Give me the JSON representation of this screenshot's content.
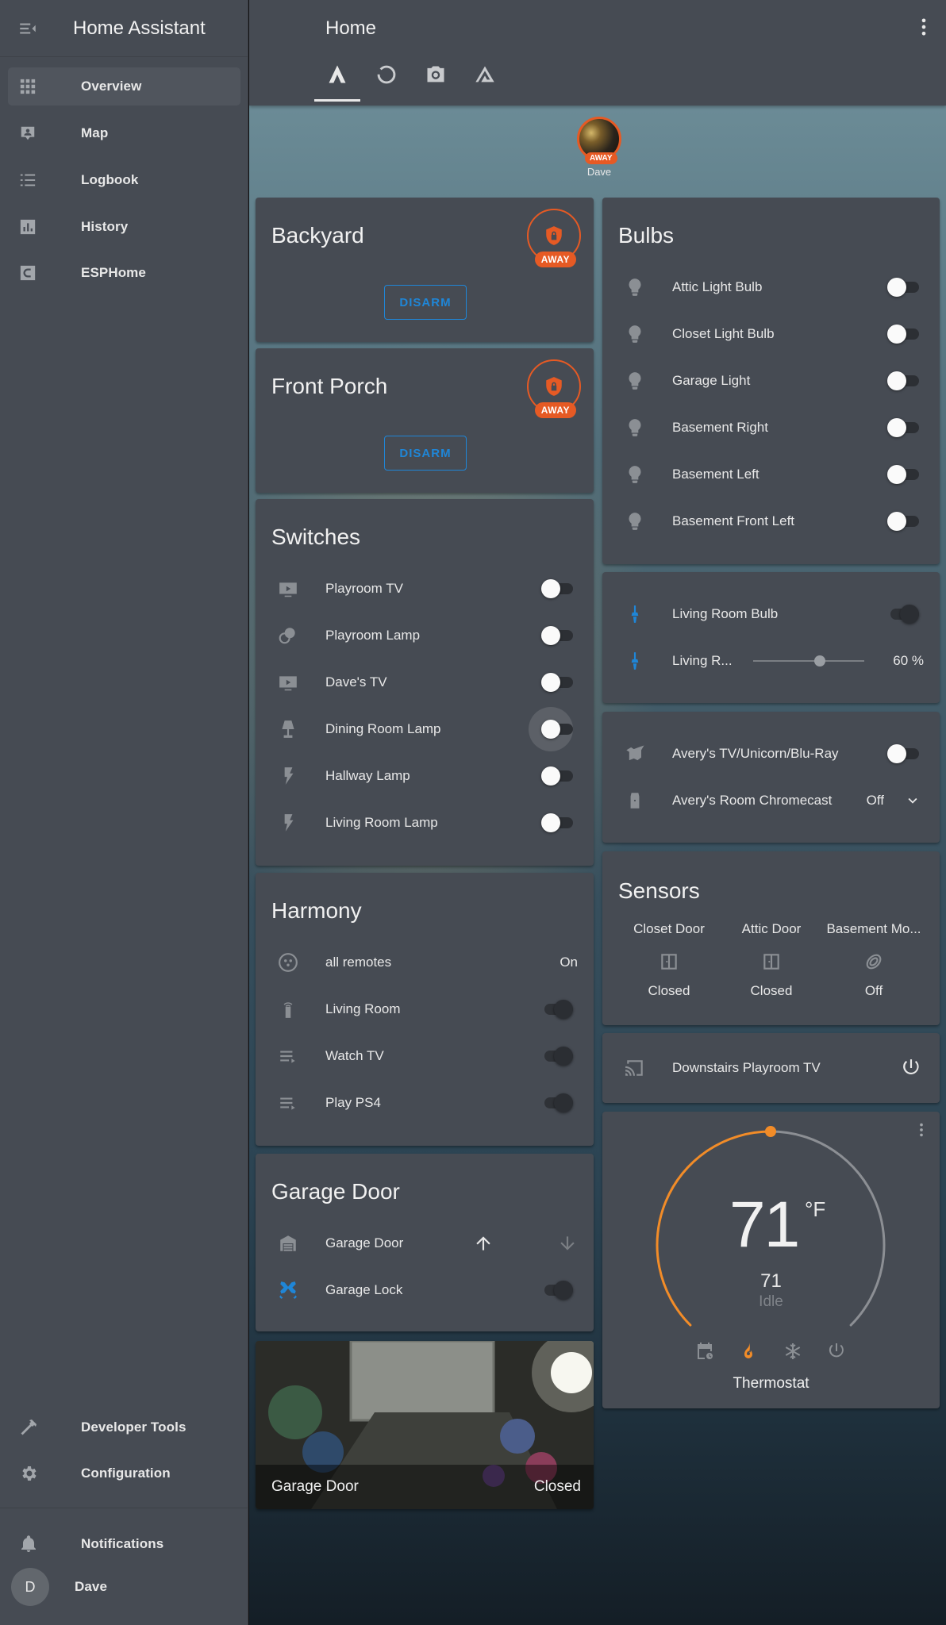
{
  "sidebar": {
    "title": "Home Assistant",
    "items": [
      {
        "label": "Overview",
        "icon": "grid-icon",
        "active": true
      },
      {
        "label": "Map",
        "icon": "map-icon"
      },
      {
        "label": "Logbook",
        "icon": "list-icon"
      },
      {
        "label": "History",
        "icon": "chart-icon"
      },
      {
        "label": "ESPHome",
        "icon": "esphome-icon"
      }
    ],
    "bottom_items": [
      {
        "label": "Developer Tools",
        "icon": "hammer-icon"
      },
      {
        "label": "Configuration",
        "icon": "gear-icon"
      }
    ],
    "notifications": "Notifications",
    "user": {
      "name": "Dave",
      "initial": "D"
    }
  },
  "header": {
    "title": "Home",
    "tabs": [
      "home-icon",
      "circle-icon",
      "camera-icon",
      "triangle-icon"
    ],
    "active_tab": 0
  },
  "badge": {
    "name": "Dave",
    "label": "AWAY",
    "color": "#e65a24"
  },
  "alarms": [
    {
      "title": "Backyard",
      "state": "AWAY",
      "action": "DISARM"
    },
    {
      "title": "Front Porch",
      "state": "AWAY",
      "action": "DISARM"
    }
  ],
  "switches": {
    "title": "Switches",
    "items": [
      {
        "label": "Playroom TV",
        "icon": "tv-icon",
        "on": false
      },
      {
        "label": "Playroom Lamp",
        "icon": "lamp-icon",
        "on": false
      },
      {
        "label": "Dave's TV",
        "icon": "tv-icon",
        "on": false
      },
      {
        "label": "Dining Room Lamp",
        "icon": "floor-lamp-icon",
        "on": false,
        "focused": true
      },
      {
        "label": "Hallway Lamp",
        "icon": "flash-icon",
        "on": false
      },
      {
        "label": "Living Room Lamp",
        "icon": "flash-icon",
        "on": false
      }
    ]
  },
  "harmony": {
    "title": "Harmony",
    "items": [
      {
        "label": "all remotes",
        "icon": "remote-icon",
        "state": "On"
      },
      {
        "label": "Living Room",
        "icon": "remote-tv-icon",
        "on": true
      },
      {
        "label": "Watch TV",
        "icon": "playlist-icon",
        "on": true
      },
      {
        "label": "Play PS4",
        "icon": "playlist-icon",
        "on": true
      }
    ]
  },
  "garage": {
    "title": "Garage Door",
    "door_label": "Garage Door",
    "lock_label": "Garage Lock",
    "lock_on": true
  },
  "camera": {
    "name": "Garage Door",
    "state": "Closed"
  },
  "bulbs": {
    "title": "Bulbs",
    "items": [
      {
        "label": "Attic Light Bulb",
        "on": false
      },
      {
        "label": "Closet Light Bulb",
        "on": false
      },
      {
        "label": "Garage Light",
        "on": false
      },
      {
        "label": "Basement Right",
        "on": false
      },
      {
        "label": "Basement Left",
        "on": false
      },
      {
        "label": "Basement Front Left",
        "on": false
      }
    ]
  },
  "living": {
    "bulb_label": "Living Room Bulb",
    "bulb_on": true,
    "slider_label": "Living R...",
    "brightness": 60,
    "brightness_text": "60 %",
    "accent": "#1f86d7"
  },
  "avery": {
    "tv_label": "Avery's TV/Unicorn/Blu-Ray",
    "tv_on": false,
    "chromecast_label": "Avery's Room Chromecast",
    "chromecast_state": "Off"
  },
  "sensors": {
    "title": "Sensors",
    "items": [
      {
        "name": "Closet Door",
        "icon": "door-icon",
        "state": "Closed"
      },
      {
        "name": "Attic Door",
        "icon": "door-icon",
        "state": "Closed"
      },
      {
        "name": "Basement Mo...",
        "icon": "motion-icon",
        "state": "Off"
      }
    ]
  },
  "media": {
    "label": "Downstairs Playroom TV"
  },
  "thermostat": {
    "temperature": "71",
    "unit": "°F",
    "target": "71",
    "action": "Idle",
    "name": "Thermostat",
    "setpoint_fraction": 0.5,
    "active_mode": "heat",
    "accent": "#f28c28"
  }
}
